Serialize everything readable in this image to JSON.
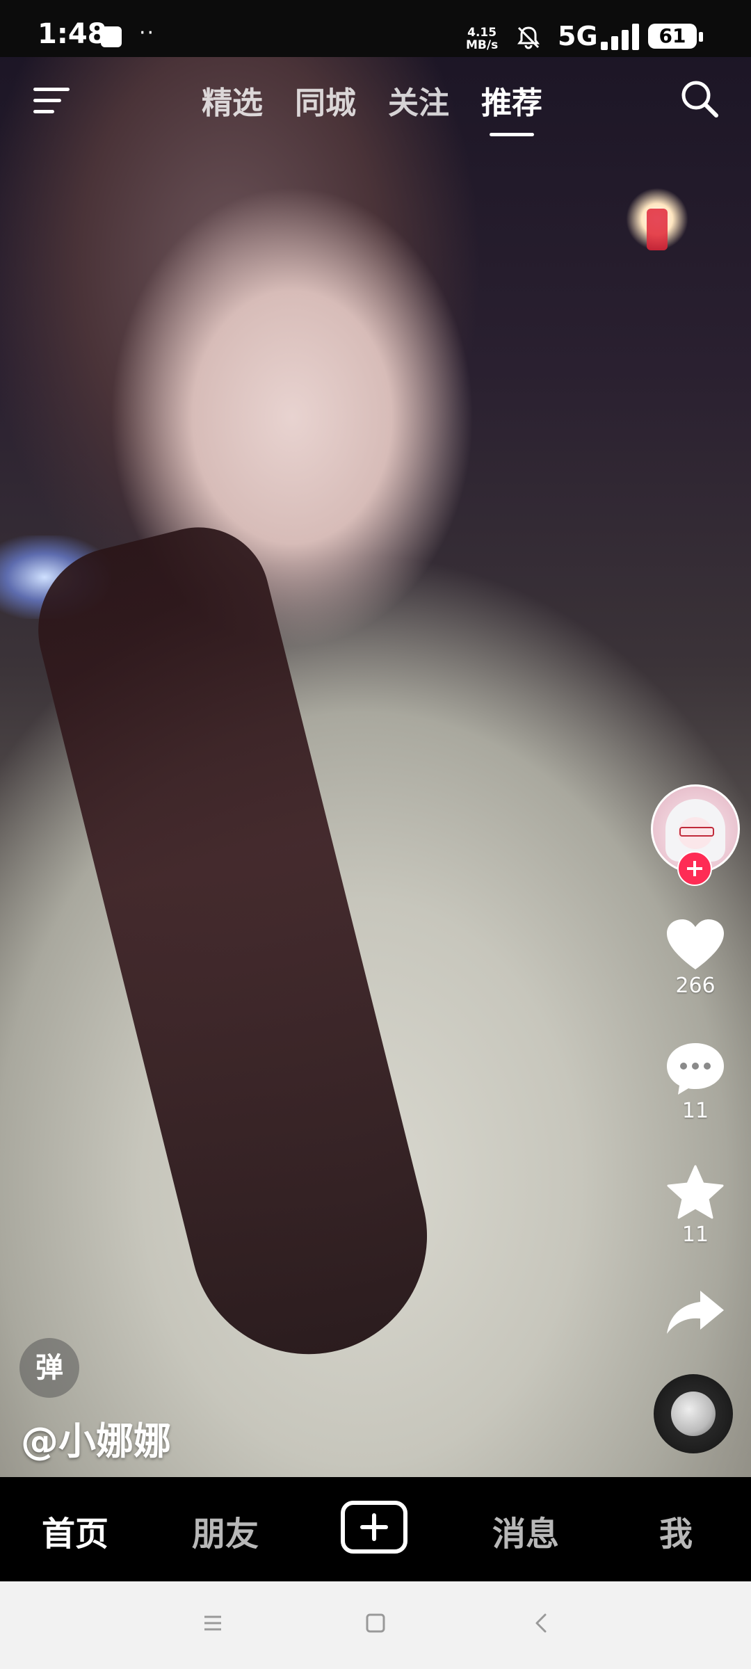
{
  "status_bar": {
    "time": "1:48",
    "net_speed_value": "4.15",
    "net_speed_unit": "MB/s",
    "network": "5G",
    "battery": "61",
    "icons": [
      "screen-record-icon",
      "more-dots-icon",
      "bell-muted-icon",
      "signal-icon",
      "battery-icon"
    ]
  },
  "top_nav": {
    "tabs": [
      "精选",
      "同城",
      "关注",
      "推荐"
    ],
    "active_tab_index": 3,
    "icons": [
      "menu-icon",
      "search-icon"
    ]
  },
  "right_rail": {
    "likes": "266",
    "comments": "11",
    "favorites": "11",
    "icons": [
      "avatar",
      "follow-plus-icon",
      "heart-icon",
      "comment-icon",
      "star-icon",
      "share-icon",
      "music-disc-icon"
    ]
  },
  "video": {
    "author": "@小娜娜",
    "danmu_label": "弹"
  },
  "bottom_tabs": {
    "items": [
      "首页",
      "朋友",
      "消息",
      "我"
    ],
    "active_index": 0,
    "create_icon": "plus-icon"
  },
  "system_nav": {
    "icons": [
      "menu-nav-icon",
      "home-nav-icon",
      "back-nav-icon"
    ]
  },
  "colors": {
    "accent": "#fe2c55",
    "bar_background": "#000000",
    "system_nav_background": "#f2f2f2"
  }
}
